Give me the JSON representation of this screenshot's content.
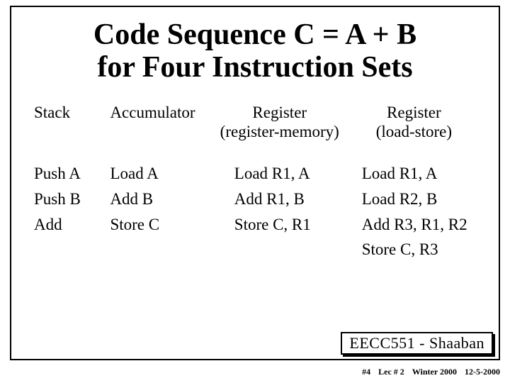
{
  "title": {
    "line1": "Code Sequence  C = A + B",
    "line2": "for Four Instruction Sets"
  },
  "headers": {
    "stack": "Stack",
    "accumulator": "Accumulator",
    "regmem_top": "Register",
    "regmem_bot": "(register-memory)",
    "loadstore_top": "Register",
    "loadstore_bot": "(load-store)"
  },
  "rows": {
    "stack": [
      "Push A",
      "Push B",
      "Add"
    ],
    "accumulator": [
      "Load  A",
      "Add  B",
      "Store C"
    ],
    "regmem": [
      "Load R1, A",
      "Add R1, B",
      "Store C, R1"
    ],
    "loadstore": [
      "Load R1, A",
      "Load R2, B",
      "Add R3, R1, R2",
      "Store C, R3"
    ]
  },
  "course": "EECC551 - Shaaban",
  "footer": {
    "page": "#4",
    "lec": "Lec # 2",
    "term": "Winter 2000",
    "date": "12-5-2000"
  }
}
